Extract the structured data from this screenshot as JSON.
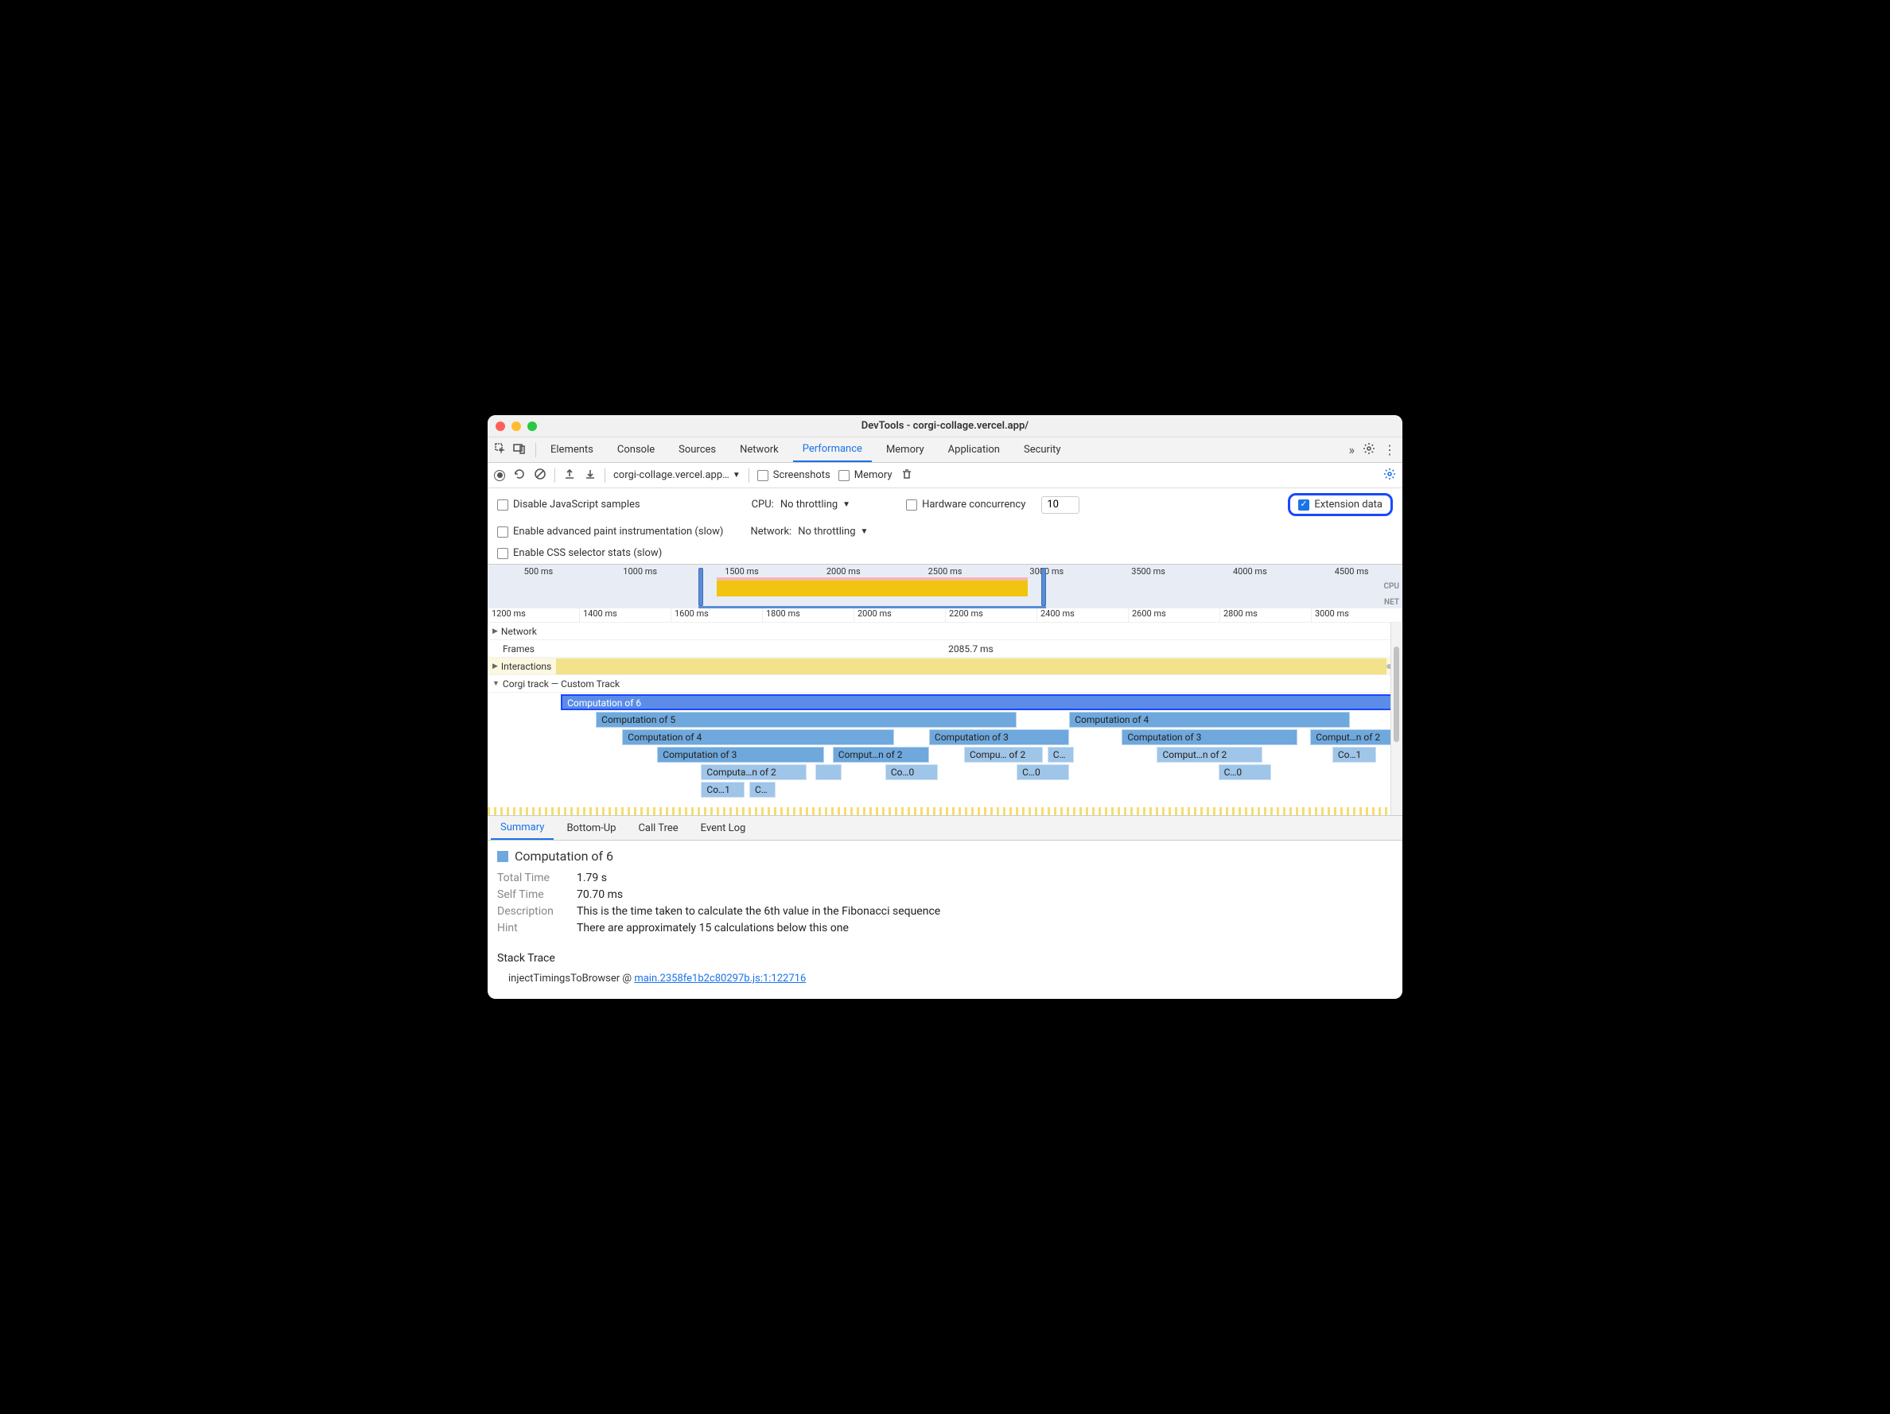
{
  "window": {
    "title": "DevTools - corgi-collage.vercel.app/"
  },
  "tabs": {
    "items": [
      "Elements",
      "Console",
      "Sources",
      "Network",
      "Performance",
      "Memory",
      "Application",
      "Security"
    ],
    "active": "Performance"
  },
  "toolbar": {
    "url": "corgi-collage.vercel.app…",
    "screenshots_label": "Screenshots",
    "memory_label": "Memory"
  },
  "settings": {
    "disable_js_label": "Disable JavaScript samples",
    "cpu_label": "CPU:",
    "cpu_value": "No throttling",
    "hw_label": "Hardware concurrency",
    "hw_value": "10",
    "ext_label": "Extension data",
    "advanced_paint_label": "Enable advanced paint instrumentation (slow)",
    "network_label": "Network:",
    "network_value": "No throttling",
    "css_stats_label": "Enable CSS selector stats (slow)"
  },
  "overview": {
    "ticks": [
      "500 ms",
      "1000 ms",
      "1500 ms",
      "2000 ms",
      "2500 ms",
      "3000 ms",
      "3500 ms",
      "4000 ms",
      "4500 ms"
    ],
    "cpu_label": "CPU",
    "net_label": "NET"
  },
  "ruler": {
    "ticks": [
      "1200 ms",
      "1400 ms",
      "1600 ms",
      "1800 ms",
      "2000 ms",
      "2200 ms",
      "2400 ms",
      "2600 ms",
      "2800 ms",
      "3000 ms"
    ]
  },
  "tracks": {
    "network": "Network",
    "frames": "Frames",
    "frames_time": "2085.7 ms",
    "interactions": "Interactions",
    "custom": "Corgi track — Custom Track"
  },
  "flame": {
    "rows": [
      [
        {
          "l": 4,
          "w": 95,
          "t": "Computation of 6",
          "sel": true
        }
      ],
      [
        {
          "l": 8,
          "w": 48,
          "t": "Computation of 5"
        },
        {
          "l": 62,
          "w": 32,
          "t": "Computation of 4"
        }
      ],
      [
        {
          "l": 11,
          "w": 31,
          "t": "Computation of 4"
        },
        {
          "l": 46,
          "w": 16,
          "t": "Computation of 3"
        },
        {
          "l": 68,
          "w": 20,
          "t": "Computation of 3"
        },
        {
          "l": 89.5,
          "w": 10,
          "t": "Comput…n of 2"
        }
      ],
      [
        {
          "l": 15,
          "w": 19,
          "t": "Computation of 3"
        },
        {
          "l": 35,
          "w": 11,
          "t": "Comput…n of 2"
        },
        {
          "l": 50,
          "w": 9,
          "t": "Compu… of 2",
          "cls": "light"
        },
        {
          "l": 59.5,
          "w": 3,
          "t": "C…",
          "cls": "light"
        },
        {
          "l": 72,
          "w": 12,
          "t": "Comput…n of 2",
          "cls": "light"
        },
        {
          "l": 92,
          "w": 5,
          "t": "Co…1",
          "cls": "light"
        }
      ],
      [
        {
          "l": 20,
          "w": 12,
          "t": "Computa…n of 2",
          "cls": "light"
        },
        {
          "l": 33,
          "w": 3,
          "t": "",
          "cls": "light"
        },
        {
          "l": 41,
          "w": 6,
          "t": "Co…0",
          "cls": "light"
        },
        {
          "l": 56,
          "w": 6,
          "t": "C…0",
          "cls": "light"
        },
        {
          "l": 79,
          "w": 6,
          "t": "C…0",
          "cls": "light"
        }
      ],
      [
        {
          "l": 20,
          "w": 5,
          "t": "Co…1",
          "cls": "light"
        },
        {
          "l": 25.5,
          "w": 3,
          "t": "C…",
          "cls": "light"
        }
      ]
    ]
  },
  "btabs": {
    "items": [
      "Summary",
      "Bottom-Up",
      "Call Tree",
      "Event Log"
    ],
    "active": "Summary"
  },
  "summary": {
    "title": "Computation of 6",
    "total_time_k": "Total Time",
    "total_time_v": "1.79 s",
    "self_time_k": "Self Time",
    "self_time_v": "70.70 ms",
    "desc_k": "Description",
    "desc_v": "This is the time taken to calculate the 6th value in the Fibonacci sequence",
    "hint_k": "Hint",
    "hint_v": "There are approximately 15 calculations below this one",
    "stack_h": "Stack Trace",
    "stack_fn": "injectTimingsToBrowser @ ",
    "stack_link": "main.2358fe1b2c80297b.js:1:122716"
  }
}
